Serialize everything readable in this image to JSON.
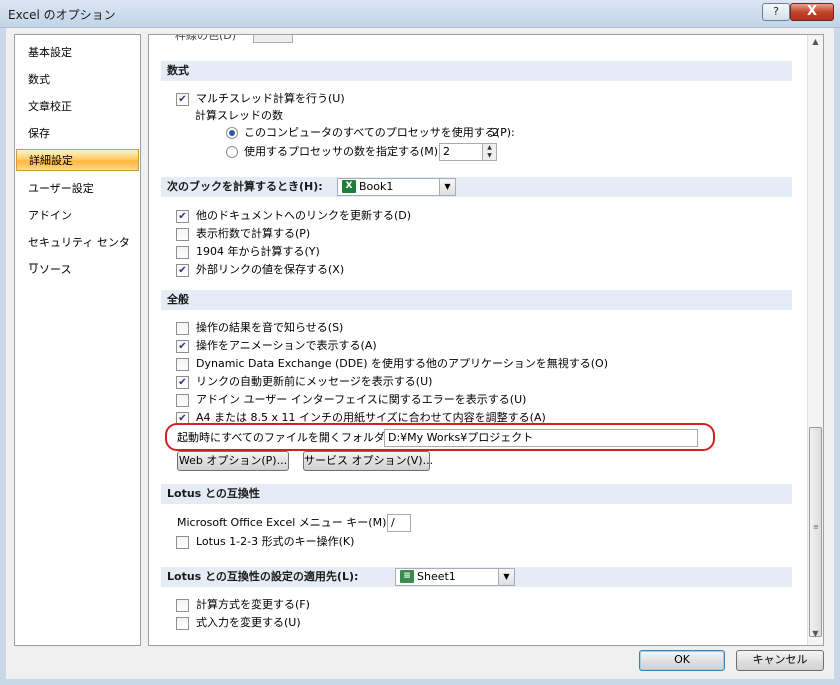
{
  "window": {
    "title": "Excel のオプション",
    "help_label": "?",
    "close_label": "X"
  },
  "nav": {
    "items": [
      "基本設定",
      "数式",
      "文章校正",
      "保存",
      "詳細設定",
      "ユーザー設定",
      "アドイン",
      "セキュリティ センター",
      "リソース"
    ],
    "active": "詳細設定"
  },
  "top_partial": {
    "label": "枠線の色(D)"
  },
  "formulas": {
    "header": "数式",
    "multithread": {
      "label": "マルチスレッド計算を行う(U)",
      "checked": true
    },
    "threads_label": "計算スレッドの数",
    "use_all": {
      "label": "このコンピュータのすべてのプロセッサを使用する(P):",
      "value": "2",
      "selected": true
    },
    "manual": {
      "label": "使用するプロセッサの数を指定する(M):",
      "value": "2",
      "selected": false
    }
  },
  "calc_book": {
    "header": "次のブックを計算するとき(H):",
    "book": "Book1",
    "options": [
      {
        "label": "他のドキュメントへのリンクを更新する(D)",
        "checked": true
      },
      {
        "label": "表示桁数で計算する(P)",
        "checked": false
      },
      {
        "label": "1904 年から計算する(Y)",
        "checked": false
      },
      {
        "label": "外部リンクの値を保存する(X)",
        "checked": true
      }
    ]
  },
  "general": {
    "header": "全般",
    "options": [
      {
        "label": "操作の結果を音で知らせる(S)",
        "checked": false
      },
      {
        "label": "操作をアニメーションで表示する(A)",
        "checked": true
      },
      {
        "label": "Dynamic Data Exchange (DDE) を使用する他のアプリケーションを無視する(O)",
        "checked": false
      },
      {
        "label": "リンクの自動更新前にメッセージを表示する(U)",
        "checked": true
      },
      {
        "label": "アドイン ユーザー インターフェイスに関するエラーを表示する(U)",
        "checked": false
      },
      {
        "label": "A4 または 8.5 x 11 インチの用紙サイズに合わせて内容を調整する(A)",
        "checked": true
      }
    ],
    "startup_folder_label": "起動時にすべてのファイルを開くフォルダ(L):",
    "startup_folder_value": "D:¥My Works¥プロジェクト",
    "web_options": "Web オプション(P)...",
    "service_options": "サービス オプション(V)..."
  },
  "lotus": {
    "header": "Lotus との互換性",
    "menu_key_label": "Microsoft Office Excel メニュー キー(M):",
    "menu_key_value": "/",
    "key_nav": {
      "label": "Lotus 1-2-3 形式のキー操作(K)",
      "checked": false
    }
  },
  "lotus_settings": {
    "header": "Lotus との互換性の設定の適用先(L):",
    "sheet": "Sheet1",
    "options": [
      {
        "label": "計算方式を変更する(F)",
        "checked": false
      },
      {
        "label": "式入力を変更する(U)",
        "checked": false
      }
    ]
  },
  "footer": {
    "ok": "OK",
    "cancel": "キャンセル"
  }
}
